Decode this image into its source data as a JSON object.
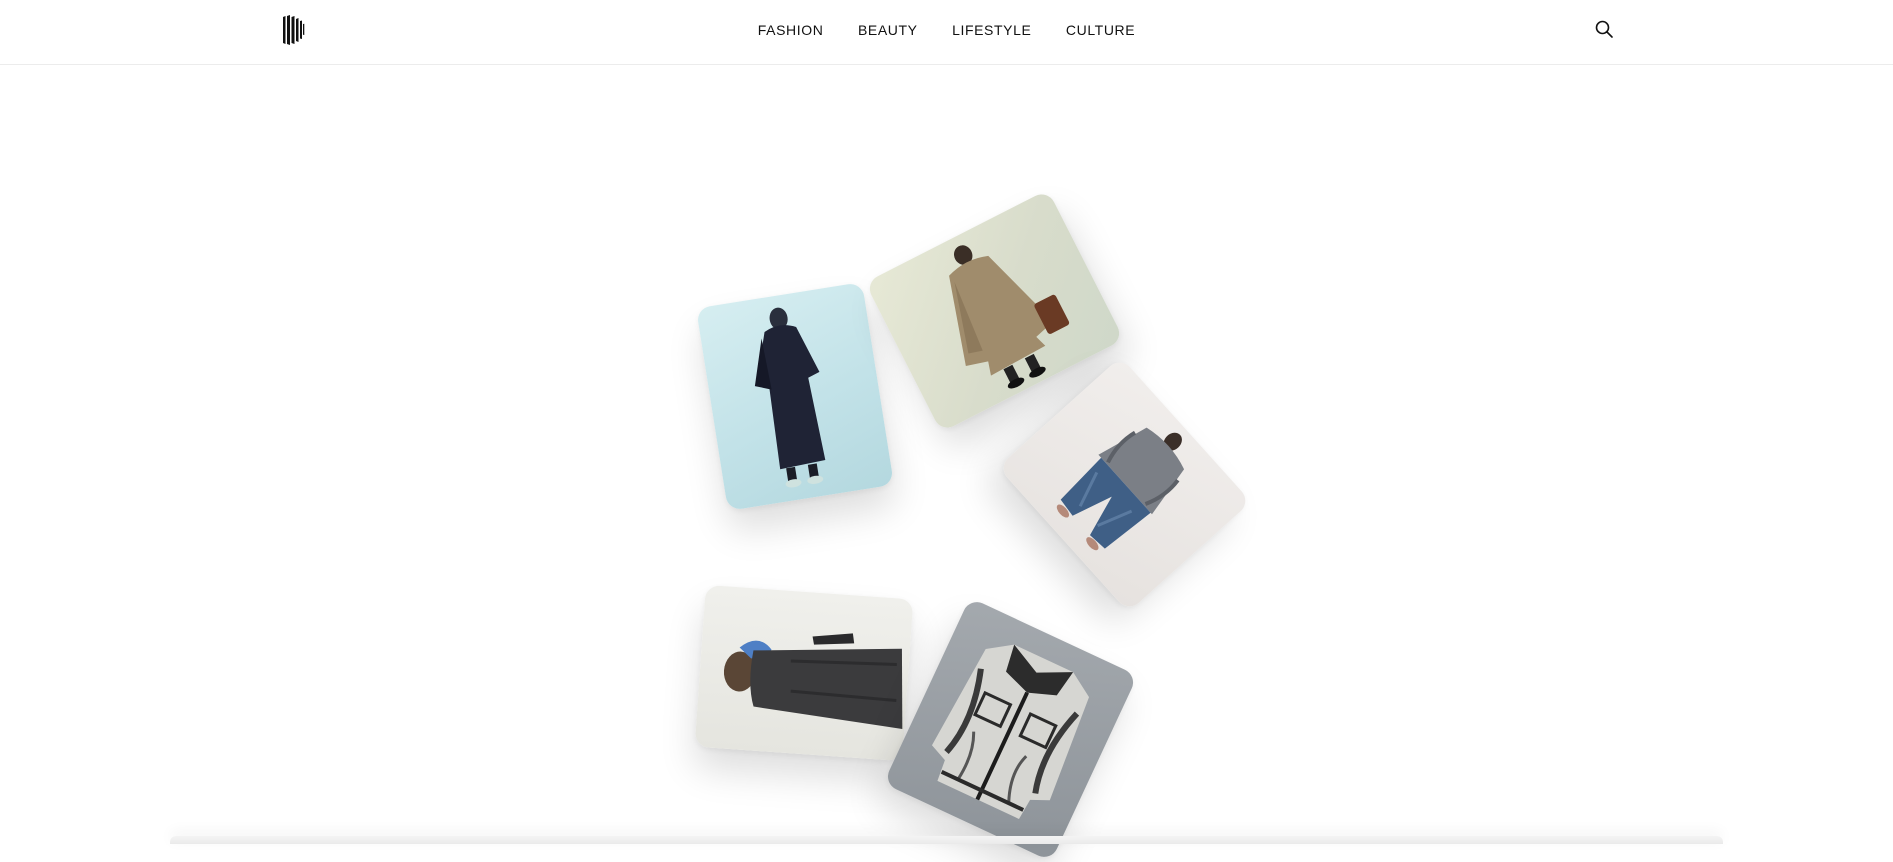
{
  "header": {
    "logo_icon": "brand-logo-icon",
    "nav": [
      {
        "label": "FASHION"
      },
      {
        "label": "BEAUTY"
      },
      {
        "label": "LIFESTYLE"
      },
      {
        "label": "CULTURE"
      }
    ],
    "search_icon": "search-icon"
  },
  "gallery": {
    "photos": [
      {
        "subject": "figure in dark navy cape coat on pale blue background"
      },
      {
        "subject": "figure in beige wide coat with brown bag on pale green background"
      },
      {
        "subject": "figure in grey puffer jacket and blue jeans on off-white background"
      },
      {
        "subject": "figure in charcoal coat with blue hood on light background"
      },
      {
        "subject": "distressed grey-black denim jacket on grey background"
      }
    ]
  },
  "colors": {
    "text": "#111111",
    "background": "#ffffff",
    "divider": "#ececec"
  }
}
